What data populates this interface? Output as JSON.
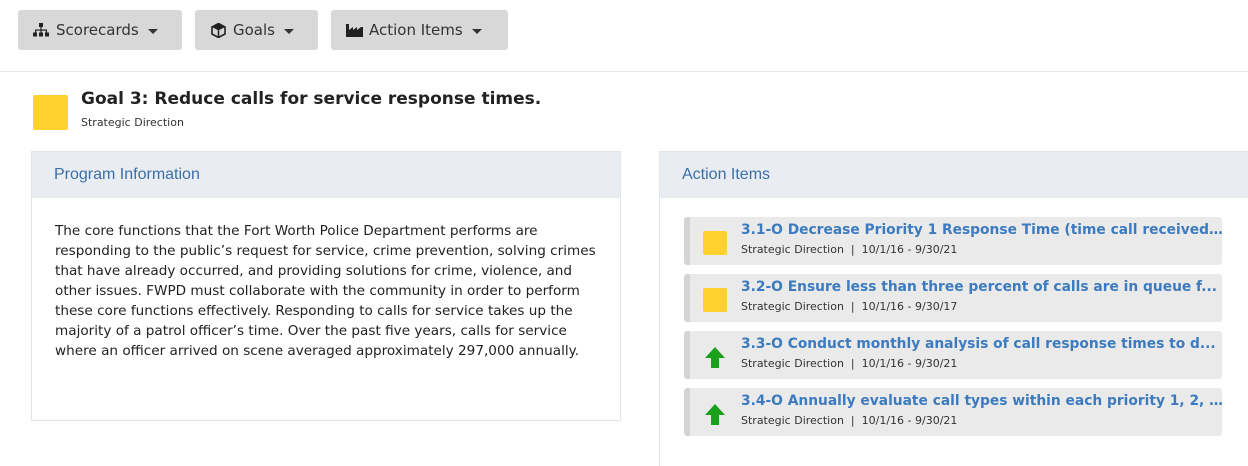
{
  "toolbar": {
    "scorecards_label": "Scorecards",
    "goals_label": "Goals",
    "action_items_label": "Action Items"
  },
  "goal": {
    "title": "Goal 3: Reduce calls for service response times.",
    "subtitle": "Strategic Direction",
    "status_color": "#fed12f"
  },
  "program_panel": {
    "heading": "Program Information",
    "body": "The core functions that the Fort Worth Police Department performs are responding to the public’s request for service, crime prevention, solving crimes that have already occurred, and providing solutions for crime, violence, and other issues. FWPD must collaborate with the community in order to perform these core functions effectively. Responding to calls for service takes up the majority of a patrol officer’s time. Over the past five years, calls for service where an officer arrived on scene averaged approximately 297,000 annually."
  },
  "actions_panel": {
    "heading": "Action Items",
    "items": [
      {
        "title": "3.1-O Decrease Priority 1 Response Time (time call received...",
        "category": "Strategic Direction",
        "dates": "10/1/16 - 9/30/21",
        "status": "yellow-square"
      },
      {
        "title": "3.2-O Ensure less than three percent of calls are in queue f...",
        "category": "Strategic Direction",
        "dates": "10/1/16 - 9/30/17",
        "status": "yellow-square"
      },
      {
        "title": "3.3-O Conduct monthly analysis of call response times to d...",
        "category": "Strategic Direction",
        "dates": "10/1/16 - 9/30/21",
        "status": "green-up-arrow"
      },
      {
        "title": "3.4-O Annually evaluate call types within each priority 1, 2, ...",
        "category": "Strategic Direction",
        "dates": "10/1/16 - 9/30/21",
        "status": "green-up-arrow"
      }
    ]
  },
  "colors": {
    "accent_blue": "#3c7bbf",
    "status_yellow": "#fed12f",
    "status_green": "#1aa01a"
  }
}
